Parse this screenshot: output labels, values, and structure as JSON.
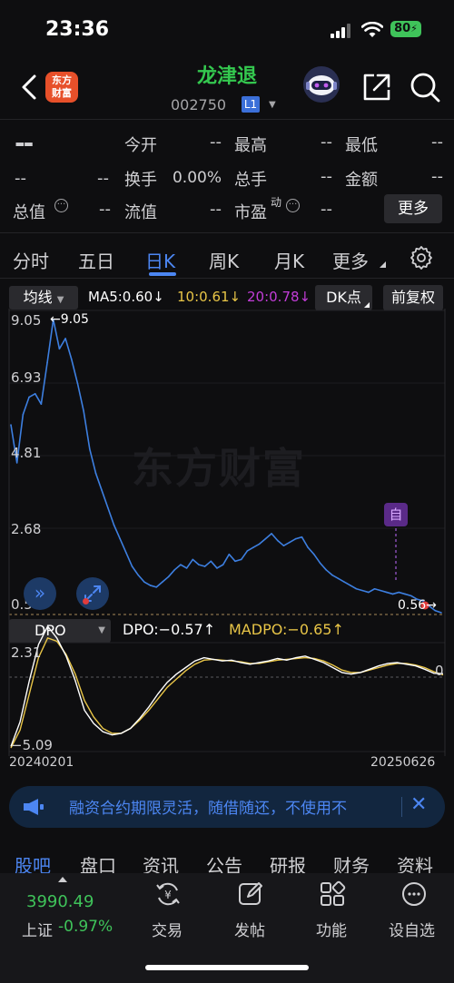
{
  "status_bar": {
    "time": "23:36",
    "battery": "80"
  },
  "header": {
    "logo_text_line1": "东方",
    "logo_text_line2": "财富",
    "stock_name": "龙津退",
    "stock_code": "002750",
    "board_badge": "L1"
  },
  "quote": {
    "price": "--",
    "change": "--",
    "change_pct": "--",
    "fields": [
      {
        "label": "今开",
        "value": "--"
      },
      {
        "label": "最高",
        "value": "--"
      },
      {
        "label": "最低",
        "value": "--"
      },
      {
        "label": "换手",
        "value": "0.00%"
      },
      {
        "label": "总手",
        "value": "--"
      },
      {
        "label": "金额",
        "value": "--"
      },
      {
        "label": "总值",
        "value": "--"
      },
      {
        "label": "流值",
        "value": "--"
      },
      {
        "label": "市盈",
        "superscript": "动",
        "value": "--"
      }
    ],
    "more_label": "更多"
  },
  "tabs": [
    "分时",
    "五日",
    "日K",
    "周K",
    "月K",
    "更多"
  ],
  "active_tab": "日K",
  "indicators": {
    "avg_label": "均线",
    "ma5": "MA5:0.60",
    "ma10": "10:0.61",
    "ma20": "20:0.78",
    "dk_label": "DK点",
    "adjust_label": "前复权"
  },
  "colors": {
    "accent": "#4c86f2",
    "price_line": "#3d7fe0",
    "ma10": "#e8c547",
    "ma20": "#c23dd8",
    "up": "#3fc35a",
    "down": "#e03c3c"
  },
  "main_chart": {
    "y_ticks": [
      "9.05",
      "6.93",
      "4.81",
      "2.68",
      "0.56"
    ],
    "high_marker": "9.05",
    "low_marker": "0.56",
    "badge": "自",
    "watermark": "东方财富"
  },
  "chart_data": {
    "type": "line",
    "x_start": "20240201",
    "x_end": "20250626",
    "ylim": [
      0.56,
      9.05
    ],
    "values": [
      6.0,
      4.9,
      6.3,
      6.8,
      6.9,
      6.6,
      7.8,
      9.05,
      8.2,
      8.5,
      7.9,
      7.2,
      6.4,
      5.3,
      4.6,
      4.1,
      3.6,
      3.1,
      2.7,
      2.3,
      1.9,
      1.65,
      1.45,
      1.35,
      1.3,
      1.45,
      1.6,
      1.8,
      1.95,
      1.85,
      2.1,
      1.95,
      1.9,
      2.05,
      1.85,
      1.95,
      2.25,
      2.05,
      2.1,
      2.35,
      2.45,
      2.55,
      2.7,
      2.85,
      2.65,
      2.5,
      2.6,
      2.7,
      2.75,
      2.45,
      2.25,
      2.0,
      1.8,
      1.65,
      1.55,
      1.45,
      1.35,
      1.25,
      1.2,
      1.15,
      1.25,
      1.2,
      1.15,
      1.1,
      1.15,
      1.1,
      1.05,
      0.95,
      0.9,
      0.75,
      0.62,
      0.56
    ]
  },
  "sub_chart": {
    "name": "DPO",
    "dpo": "DPO:−0.57",
    "madpo": "MADPO:−0.65",
    "y_top": "2.31",
    "y_zero": "0",
    "y_bottom": "−5.09",
    "x_start": "20240201",
    "x_end": "20250626",
    "dpo_values": [
      -5.0,
      -3.5,
      -1.0,
      1.2,
      2.31,
      1.6,
      0.5,
      -1.0,
      -2.8,
      -3.6,
      -4.1,
      -4.3,
      -4.2,
      -3.9,
      -3.3,
      -2.6,
      -1.8,
      -1.1,
      -0.6,
      -0.2,
      0.2,
      0.4,
      0.3,
      0.2,
      0.25,
      0.1,
      0.0,
      0.1,
      0.2,
      0.35,
      0.25,
      0.4,
      0.5,
      0.3,
      0.1,
      -0.2,
      -0.5,
      -0.6,
      -0.5,
      -0.3,
      -0.1,
      0.05,
      0.1,
      0.0,
      -0.1,
      -0.3,
      -0.55,
      -0.57
    ],
    "madpo_values": [
      -5.09,
      -4.0,
      -1.8,
      0.4,
      1.6,
      1.4,
      0.6,
      -0.6,
      -2.2,
      -3.2,
      -3.9,
      -4.2,
      -4.2,
      -3.9,
      -3.4,
      -2.8,
      -2.1,
      -1.4,
      -0.9,
      -0.4,
      0.0,
      0.25,
      0.3,
      0.25,
      0.2,
      0.15,
      0.05,
      0.05,
      0.15,
      0.25,
      0.3,
      0.35,
      0.4,
      0.35,
      0.2,
      -0.05,
      -0.35,
      -0.5,
      -0.5,
      -0.35,
      -0.2,
      -0.05,
      0.05,
      0.05,
      -0.05,
      -0.2,
      -0.45,
      -0.65
    ]
  },
  "banner": {
    "text": "融资合约期限灵活，随借随还，不使用不"
  },
  "bottom_tabs": [
    "股吧",
    "盘口",
    "资讯",
    "公告",
    "研报",
    "财务",
    "资料"
  ],
  "active_bottom_tab": "股吧",
  "index": {
    "value": "3990.49",
    "name": "上证",
    "change_pct": "-0.97%"
  },
  "bottom_nav": [
    {
      "label": "交易",
      "icon": "yen-swap-icon"
    },
    {
      "label": "发帖",
      "icon": "edit-icon"
    },
    {
      "label": "功能",
      "icon": "grid-icon"
    },
    {
      "label": "设自选",
      "icon": "more-circle-icon"
    }
  ]
}
